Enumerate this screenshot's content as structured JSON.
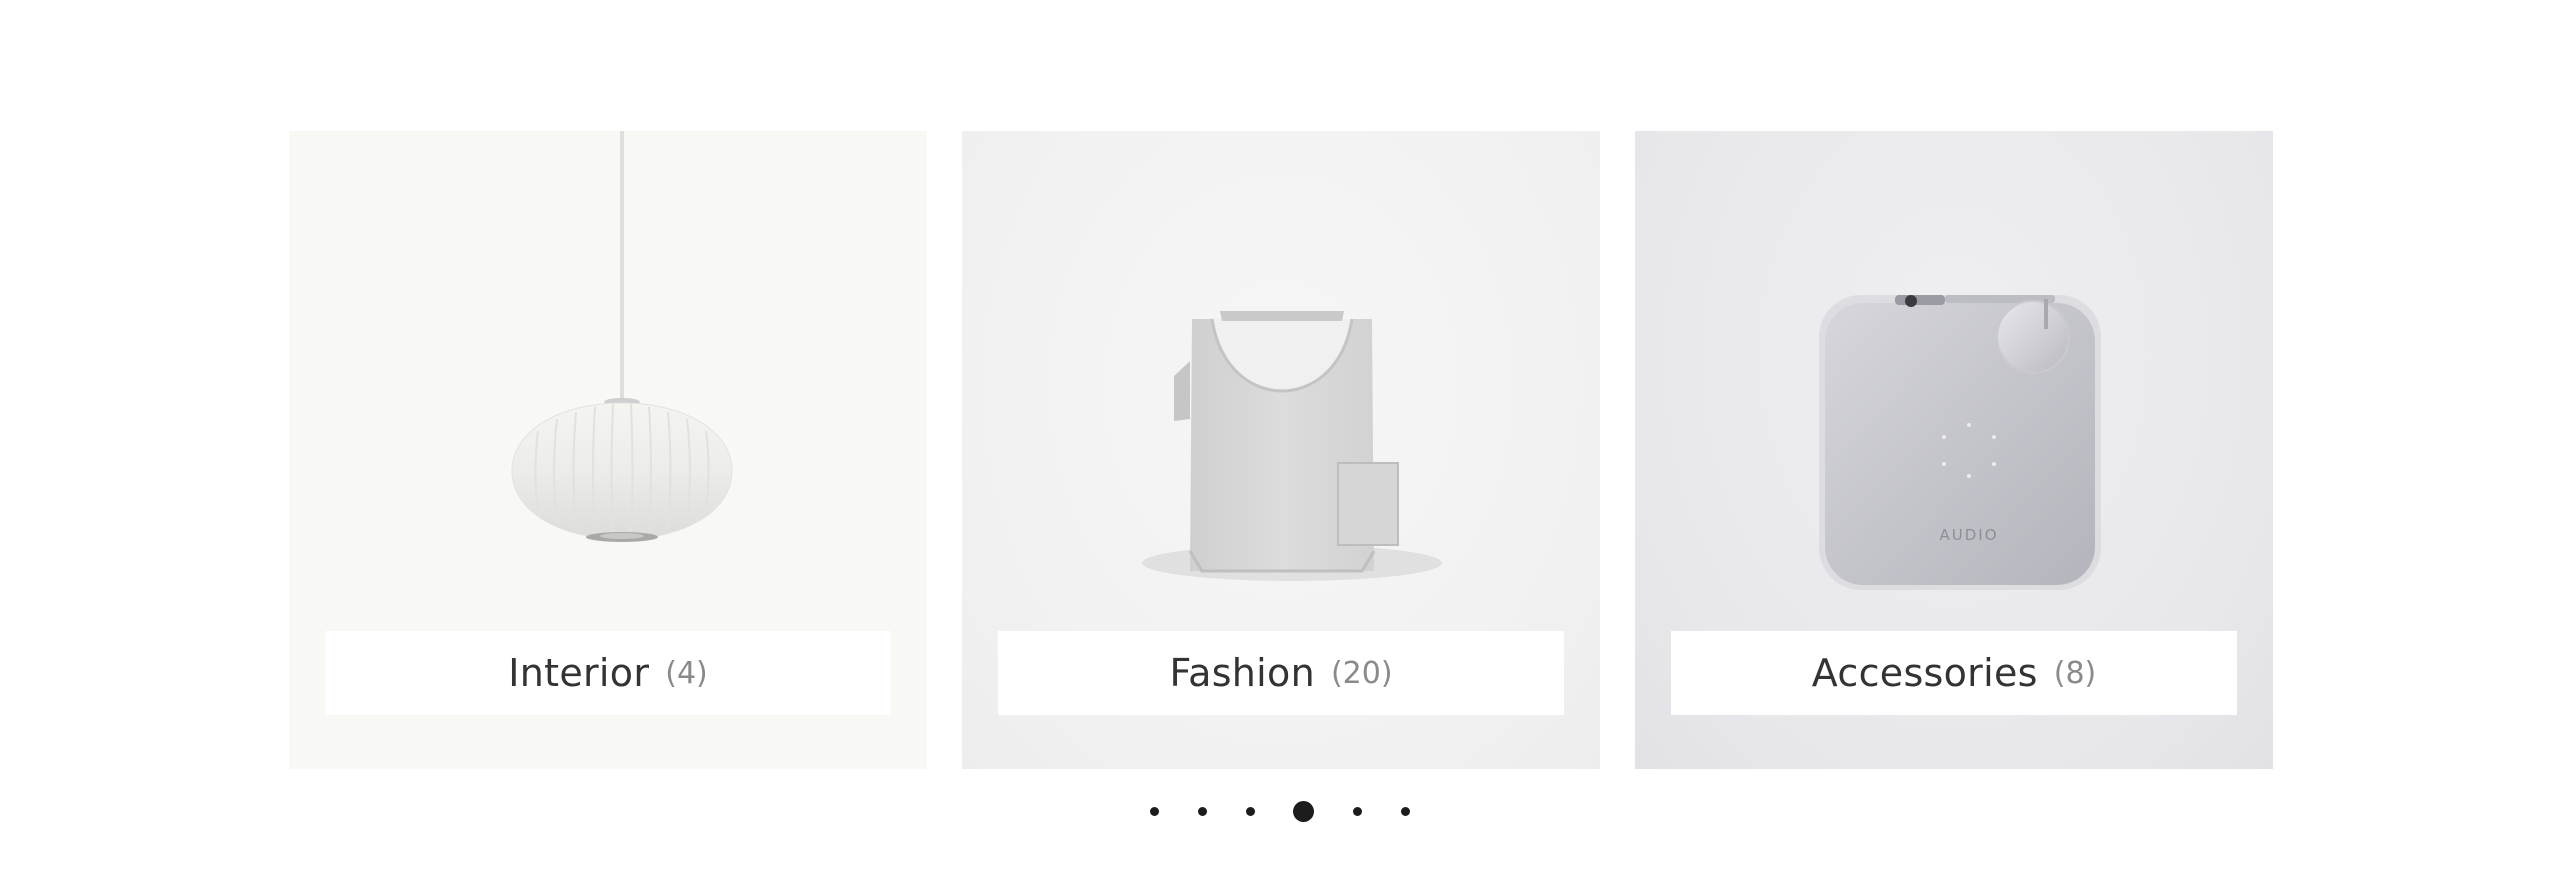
{
  "categories": [
    {
      "name": "Interior",
      "count": "(4)",
      "icon": "pendant-lamp-icon"
    },
    {
      "name": "Fashion",
      "count": "(20)",
      "icon": "bag-icon"
    },
    {
      "name": "Accessories",
      "count": "(8)",
      "icon": "audio-device-icon",
      "device_text": "AUDIO"
    }
  ],
  "pagination": {
    "total": 6,
    "active_index": 3
  },
  "colors": {
    "label_text": "#333333",
    "count_text": "#8a8a8a",
    "dot": "#1c1c1c"
  }
}
